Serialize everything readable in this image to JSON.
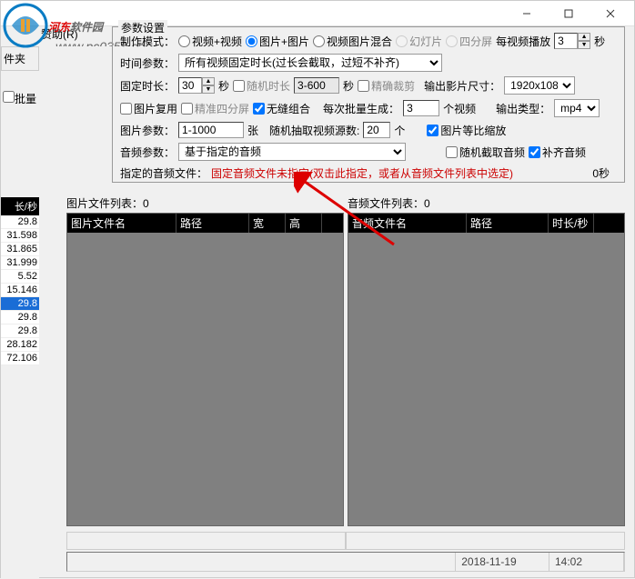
{
  "watermark": {
    "brand_part1": "河东",
    "brand_part2": "软件园",
    "url": "www.pc0359.cn"
  },
  "menu": {
    "help": "帮助(H)",
    "sponsor": "赞助(R)"
  },
  "left": {
    "header": "件夹",
    "batch_chk": "批量",
    "col_header": "长/秒",
    "rows": [
      "29.8",
      "31.598",
      "31.865",
      "31.999",
      "5.52",
      "15.146",
      "29.8",
      "29.8",
      "29.8",
      "28.182",
      "72.106"
    ],
    "selected_index": 6
  },
  "params": {
    "legend": "参数设置",
    "mode_label": "制作模式：",
    "mode_opts": [
      "视频+视频",
      "图片+图片",
      "视频图片混合",
      "幻灯片",
      "四分屏"
    ],
    "per_video_label": "每视频播放",
    "per_video_value": "3",
    "per_video_unit": "秒",
    "duration_label": "时间参数：",
    "duration_select": "所有视频固定时长(过长会截取，过短不补齐)",
    "fixed_len_label": "固定时长：",
    "fixed_len_value": "30",
    "fixed_len_unit": "秒",
    "random_len_chk": "随机时长",
    "random_len_value": "3-600",
    "random_len_unit": "秒",
    "precise_crop": "精确裁剪",
    "output_size_label": "输出影片尺寸：",
    "output_size_value": "1920x1080",
    "img_reuse": "图片复用",
    "precise_quad": "精准四分屏",
    "seamless": "无缝组合",
    "batch_gen_label": "每次批量生成：",
    "batch_gen_value": "3",
    "batch_gen_unit": "个视频",
    "output_type_label": "输出类型：",
    "output_type_value": "mp4",
    "img_params_label": "图片参数：",
    "img_params_value": "1-1000",
    "img_params_unit": "张",
    "random_extract_label": "随机抽取视频源数:",
    "random_extract_value": "20",
    "random_extract_unit": "个",
    "img_scale": "图片等比缩放",
    "audio_params_label": "音频参数：",
    "audio_params_value": "基于指定的音频",
    "random_audio": "随机截取音频",
    "pad_audio": "补齐音频",
    "audio_file_label": "指定的音频文件：",
    "audio_file_text": "固定音频文件未指定(双击此指定，或者从音频文件列表中选定)",
    "audio_file_time": "0秒"
  },
  "lists": {
    "img_title": "图片文件列表：0",
    "img_cols": [
      "图片文件名",
      "路径",
      "宽",
      "高"
    ],
    "aud_title": "音频文件列表：0",
    "aud_cols": [
      "音频文件名",
      "路径",
      "时长/秒"
    ]
  },
  "status": {
    "date": "2018-11-19",
    "time": "14:02"
  }
}
